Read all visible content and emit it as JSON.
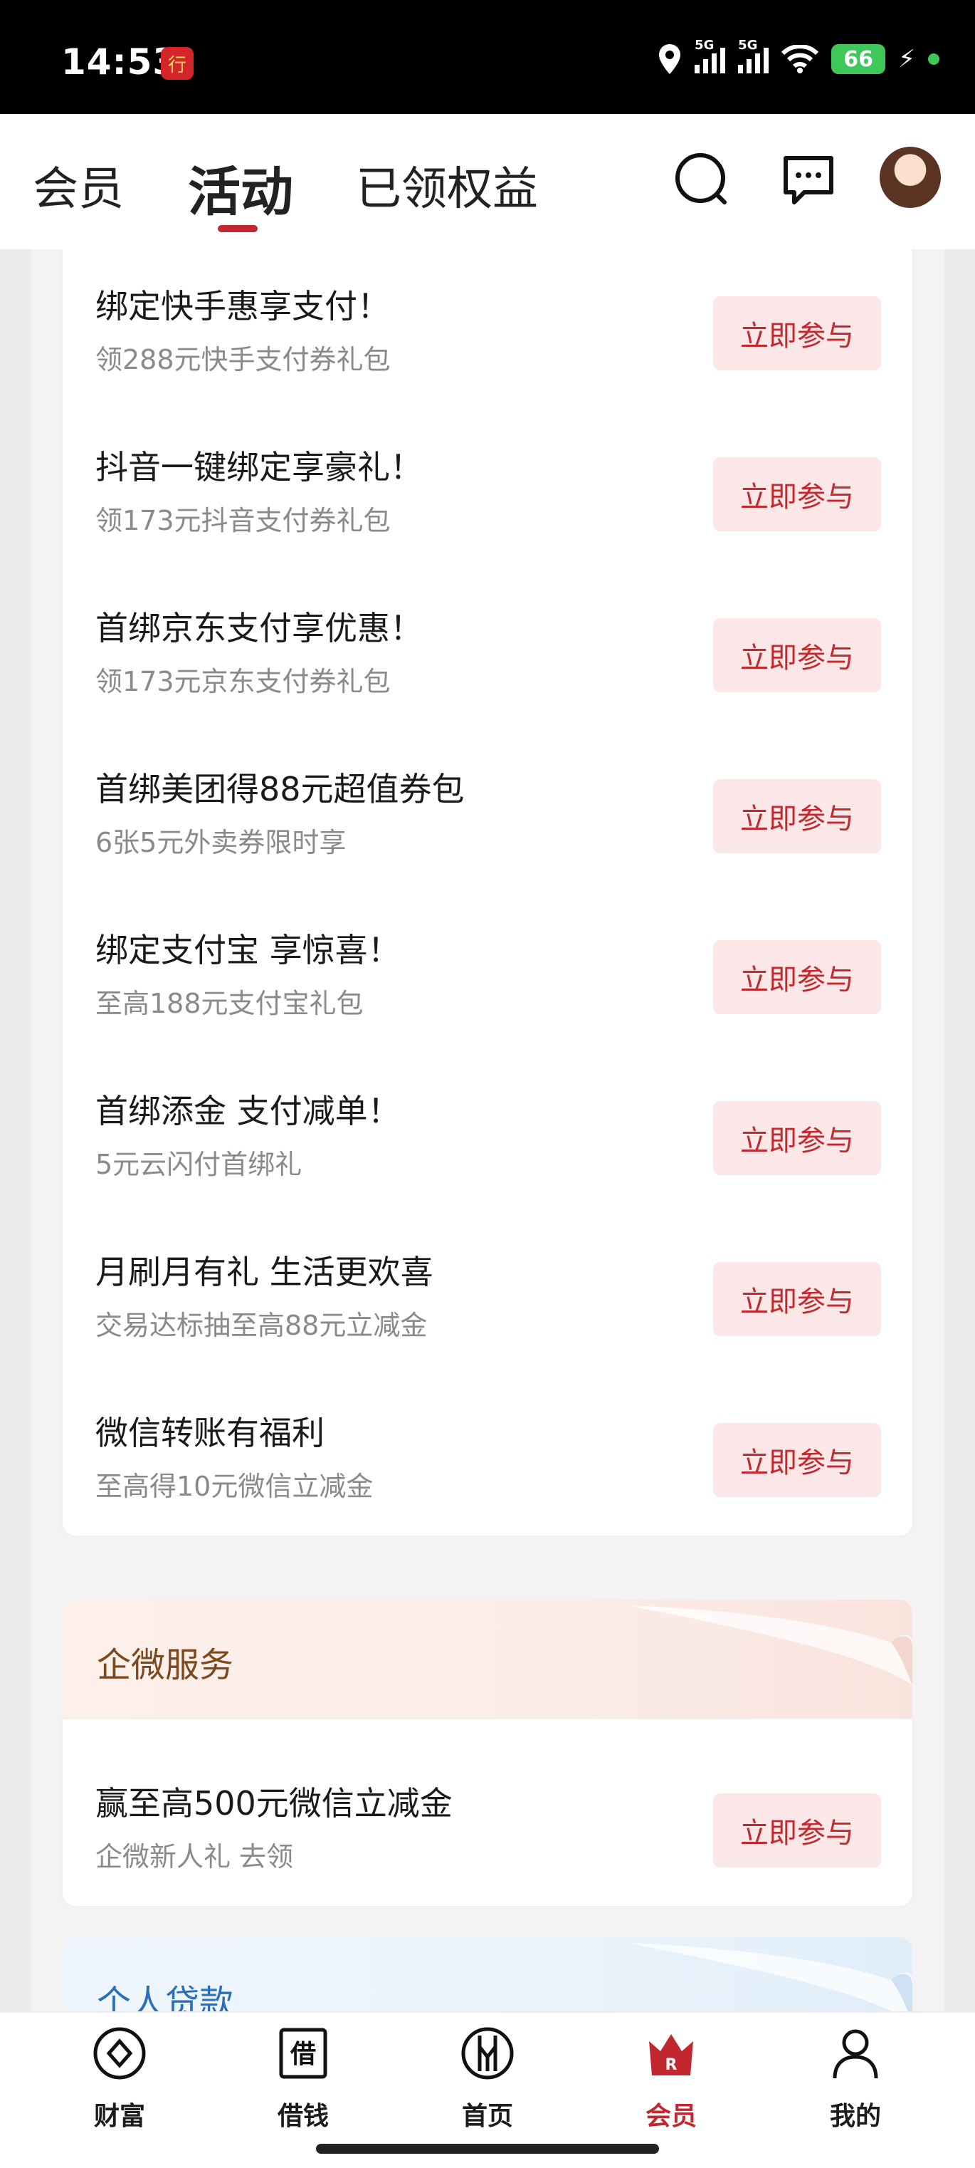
{
  "status_bar": {
    "time": "14:53",
    "net1": "5G",
    "net2": "5G",
    "battery": "66",
    "app_icon": "bank-app-icon"
  },
  "header": {
    "tabs": [
      {
        "label": "会员"
      },
      {
        "label": "活动"
      },
      {
        "label": "已领权益"
      }
    ],
    "active_tab": 1,
    "icons": [
      "search-icon",
      "message-icon",
      "avatar"
    ]
  },
  "activities": [
    {
      "title": "绑定快手惠享支付！",
      "subtitle": "领288元快手支付券礼包",
      "button": "立即参与"
    },
    {
      "title": "抖音一键绑定享豪礼！",
      "subtitle": "领173元抖音支付券礼包",
      "button": "立即参与"
    },
    {
      "title": "首绑京东支付享优惠！",
      "subtitle": "领173元京东支付券礼包",
      "button": "立即参与"
    },
    {
      "title": "首绑美团得88元超值券包",
      "subtitle": "6张5元外卖券限时享",
      "button": "立即参与"
    },
    {
      "title": "绑定支付宝 享惊喜！",
      "subtitle": "至高188元支付宝礼包",
      "button": "立即参与"
    },
    {
      "title": "首绑添金 支付减单！",
      "subtitle": "5元云闪付首绑礼",
      "button": "立即参与"
    },
    {
      "title": "月刷月有礼 生活更欢喜",
      "subtitle": "交易达标抽至高88元立减金",
      "button": "立即参与"
    },
    {
      "title": "微信转账有福利",
      "subtitle": "至高得10元微信立减金",
      "button": "立即参与"
    }
  ],
  "wecom_section": {
    "title": "企微服务",
    "title_color": "#7a4a1e",
    "item": {
      "title": "赢至高500元微信立减金",
      "subtitle": "企微新人礼 去领",
      "button": "立即参与"
    }
  },
  "loan_section": {
    "title": "个人贷款",
    "title_color": "#2a6fb8"
  },
  "bottom_nav": {
    "items": [
      {
        "label": "财富",
        "icon": "wealth-icon"
      },
      {
        "label": "借钱",
        "icon": "borrow-icon"
      },
      {
        "label": "首页",
        "icon": "home-icon"
      },
      {
        "label": "会员",
        "icon": "member-crown-icon"
      },
      {
        "label": "我的",
        "icon": "profile-icon"
      }
    ],
    "active": 3
  },
  "colors": {
    "accent": "#c2262e",
    "button_bg": "#fbe7e7"
  }
}
